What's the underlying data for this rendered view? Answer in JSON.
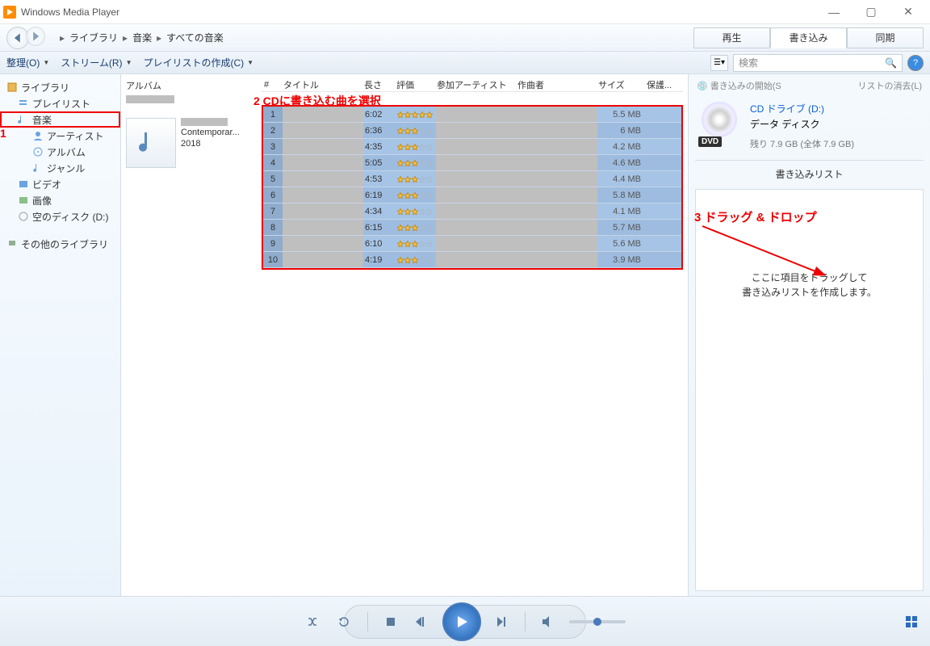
{
  "title": "Windows Media Player",
  "breadcrumb": {
    "p1": "ライブラリ",
    "p2": "音楽",
    "p3": "すべての音楽"
  },
  "tabs": {
    "play": "再生",
    "burn": "書き込み",
    "sync": "同期"
  },
  "toolbar": {
    "organize": "整理(O)",
    "stream": "ストリーム(R)",
    "createPlaylist": "プレイリストの作成(C)",
    "searchPlaceholder": "検索"
  },
  "sidebar": {
    "library": "ライブラリ",
    "playlist": "プレイリスト",
    "music": "音楽",
    "artist": "アーティスト",
    "album": "アルバム",
    "genre": "ジャンル",
    "video": "ビデオ",
    "picture": "画像",
    "emptyDisc": "空のディスク (D:)",
    "otherLibrary": "その他のライブラリ"
  },
  "columns": {
    "album": "アルバム",
    "num": "#",
    "title": "タイトル",
    "length": "長さ",
    "rating": "評価",
    "artist": "参加アーティスト",
    "composer": "作曲者",
    "size": "サイズ",
    "protected": "保護..."
  },
  "album": {
    "genre": "Contemporar...",
    "year": "2018"
  },
  "tracks": [
    {
      "n": 1,
      "len": "6:02",
      "stars": 5,
      "size": "5.5 MB"
    },
    {
      "n": 2,
      "len": "6:36",
      "stars": 3,
      "size": "6 MB"
    },
    {
      "n": 3,
      "len": "4:35",
      "stars": 3,
      "size": "4.2 MB"
    },
    {
      "n": 4,
      "len": "5:05",
      "stars": 3,
      "size": "4.6 MB"
    },
    {
      "n": 5,
      "len": "4:53",
      "stars": 3,
      "size": "4.4 MB"
    },
    {
      "n": 6,
      "len": "6:19",
      "stars": 3,
      "size": "5.8 MB"
    },
    {
      "n": 7,
      "len": "4:34",
      "stars": 3,
      "size": "4.1 MB"
    },
    {
      "n": 8,
      "len": "6:15",
      "stars": 3,
      "size": "5.7 MB"
    },
    {
      "n": 9,
      "len": "6:10",
      "stars": 3,
      "size": "5.6 MB"
    },
    {
      "n": 10,
      "len": "4:19",
      "stars": 3,
      "size": "3.9 MB"
    }
  ],
  "right": {
    "startBurn": "書き込みの開始(S",
    "clearList": "リストの消去(L)",
    "drive": "CD ドライブ (D:)",
    "discType": "データ ディスク",
    "space": "残り 7.9 GB (全体 7.9 GB)",
    "burnList": "書き込みリスト",
    "drag1": "ここに項目をドラッグして",
    "drag2": "書き込みリストを作成します。"
  },
  "annotations": {
    "a1": "1",
    "a2": "2 CDに書き込む曲を選択",
    "a3": "3  ドラッグ & ドロップ"
  }
}
